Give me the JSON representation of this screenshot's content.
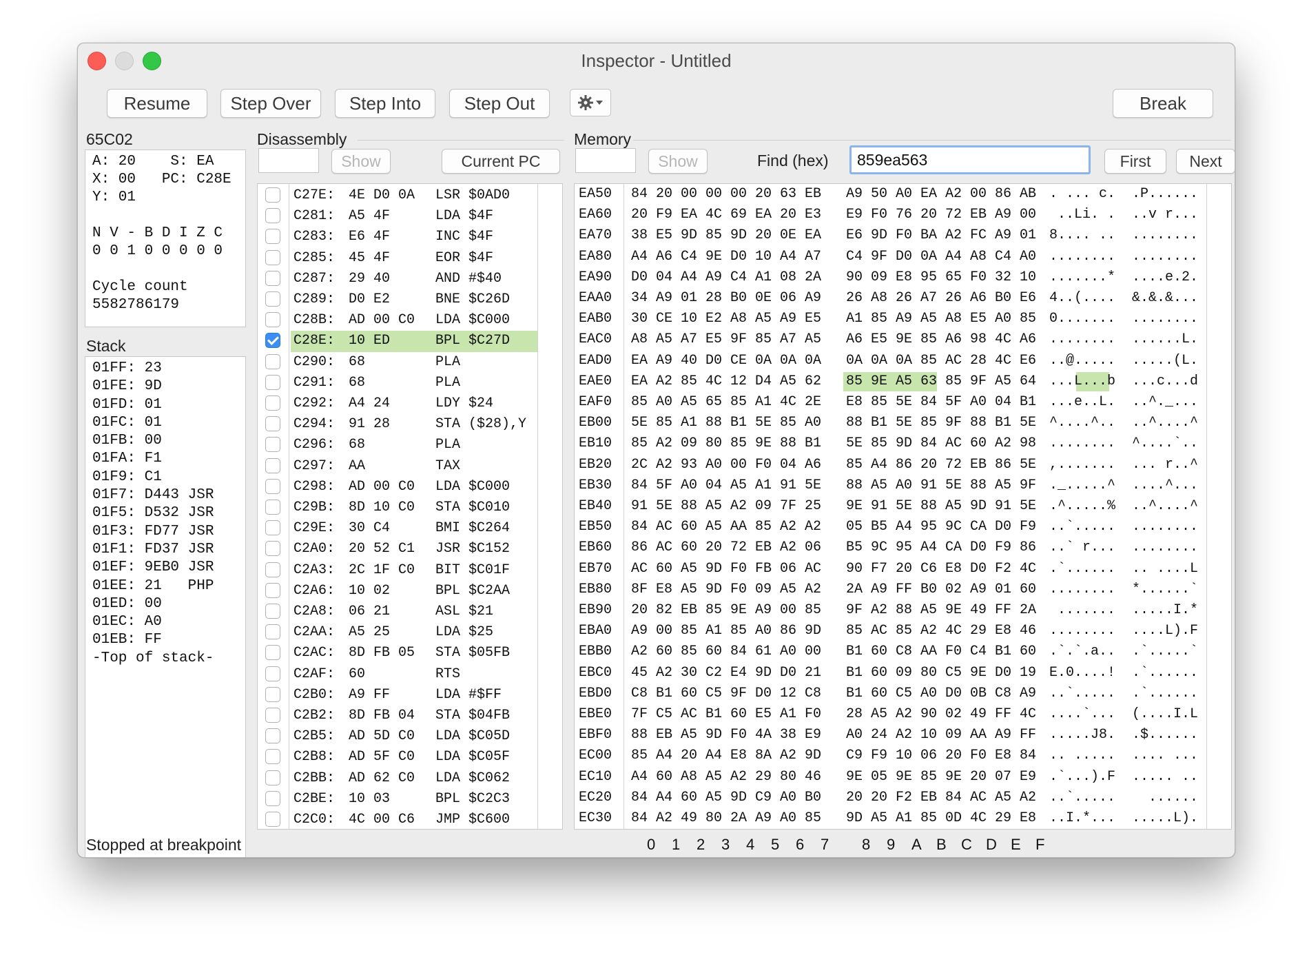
{
  "window": {
    "title": "Inspector - Untitled"
  },
  "toolbar": {
    "resume": "Resume",
    "step_over": "Step Over",
    "step_into": "Step Into",
    "step_out": "Step Out",
    "break": "Break"
  },
  "cpu": {
    "label": "65C02",
    "lines": [
      "A: 20    S: EA",
      "X: 00   PC: C28E",
      "Y: 01",
      "",
      "N V - B D I Z C",
      "0 0 1 0 0 0 0 0",
      "",
      "Cycle count",
      "5582786179"
    ]
  },
  "stack": {
    "label": "Stack",
    "lines": [
      "01FF: 23",
      "01FE: 9D",
      "01FD: 01",
      "01FC: 01",
      "01FB: 00",
      "01FA: F1",
      "01F9: C1",
      "01F7: D443 JSR",
      "01F5: D532 JSR",
      "01F3: FD77 JSR",
      "01F1: FD37 JSR",
      "01EF: 9EB0 JSR",
      "01EE: 21   PHP",
      "01ED: 00",
      "01EC: A0",
      "01EB: FF",
      "-Top of stack-"
    ]
  },
  "disassembly": {
    "label": "Disassembly",
    "show": "Show",
    "current_pc": "Current PC",
    "rows": [
      {
        "addr": "C27E:",
        "bytes": "4E D0 0A",
        "instr": "LSR $0AD0"
      },
      {
        "addr": "C281:",
        "bytes": "A5 4F",
        "instr": "LDA $4F"
      },
      {
        "addr": "C283:",
        "bytes": "E6 4F",
        "instr": "INC $4F"
      },
      {
        "addr": "C285:",
        "bytes": "45 4F",
        "instr": "EOR $4F"
      },
      {
        "addr": "C287:",
        "bytes": "29 40",
        "instr": "AND #$40"
      },
      {
        "addr": "C289:",
        "bytes": "D0 E2",
        "instr": "BNE $C26D"
      },
      {
        "addr": "C28B:",
        "bytes": "AD 00 C0",
        "instr": "LDA $C000"
      },
      {
        "addr": "C28E:",
        "bytes": "10 ED",
        "instr": "BPL $C27D"
      },
      {
        "addr": "C290:",
        "bytes": "68",
        "instr": "PLA"
      },
      {
        "addr": "C291:",
        "bytes": "68",
        "instr": "PLA"
      },
      {
        "addr": "C292:",
        "bytes": "A4 24",
        "instr": "LDY $24"
      },
      {
        "addr": "C294:",
        "bytes": "91 28",
        "instr": "STA ($28),Y"
      },
      {
        "addr": "C296:",
        "bytes": "68",
        "instr": "PLA"
      },
      {
        "addr": "C297:",
        "bytes": "AA",
        "instr": "TAX"
      },
      {
        "addr": "C298:",
        "bytes": "AD 00 C0",
        "instr": "LDA $C000"
      },
      {
        "addr": "C29B:",
        "bytes": "8D 10 C0",
        "instr": "STA $C010"
      },
      {
        "addr": "C29E:",
        "bytes": "30 C4",
        "instr": "BMI $C264"
      },
      {
        "addr": "C2A0:",
        "bytes": "20 52 C1",
        "instr": "JSR $C152"
      },
      {
        "addr": "C2A3:",
        "bytes": "2C 1F C0",
        "instr": "BIT $C01F"
      },
      {
        "addr": "C2A6:",
        "bytes": "10 02",
        "instr": "BPL $C2AA"
      },
      {
        "addr": "C2A8:",
        "bytes": "06 21",
        "instr": "ASL $21"
      },
      {
        "addr": "C2AA:",
        "bytes": "A5 25",
        "instr": "LDA $25"
      },
      {
        "addr": "C2AC:",
        "bytes": "8D FB 05",
        "instr": "STA $05FB"
      },
      {
        "addr": "C2AF:",
        "bytes": "60",
        "instr": "RTS"
      },
      {
        "addr": "C2B0:",
        "bytes": "A9 FF",
        "instr": "LDA #$FF"
      },
      {
        "addr": "C2B2:",
        "bytes": "8D FB 04",
        "instr": "STA $04FB"
      },
      {
        "addr": "C2B5:",
        "bytes": "AD 5D C0",
        "instr": "LDA $C05D"
      },
      {
        "addr": "C2B8:",
        "bytes": "AD 5F C0",
        "instr": "LDA $C05F"
      },
      {
        "addr": "C2BB:",
        "bytes": "AD 62 C0",
        "instr": "LDA $C062"
      },
      {
        "addr": "C2BE:",
        "bytes": "10 03",
        "instr": "BPL $C2C3"
      },
      {
        "addr": "C2C0:",
        "bytes": "4C 00 C6",
        "instr": "JMP $C600"
      }
    ],
    "checked_row": 7
  },
  "memory": {
    "label": "Memory",
    "show": "Show",
    "find_label": "Find (hex)",
    "find_value": "859ea563",
    "first": "First",
    "next": "Next",
    "rows": [
      {
        "a": "EA50",
        "b1": "84 20 00 00 00 20 63 EB",
        "b2": "A9 50 A0 EA A2 00 86 AB",
        "c": ". ... c.  .P......"
      },
      {
        "a": "EA60",
        "b1": "20 F9 EA 4C 69 EA 20 E3",
        "b2": "E9 F0 76 20 72 EB A9 00",
        "c": " ..Li. .  ..v r..."
      },
      {
        "a": "EA70",
        "b1": "38 E5 9D 85 9D 20 0E EA",
        "b2": "E6 9D F0 BA A2 FC A9 01",
        "c": "8.... ..  ........"
      },
      {
        "a": "EA80",
        "b1": "A4 A6 C4 9E D0 10 A4 A7",
        "b2": "C4 9F D0 0A A4 A8 C4 A0",
        "c": "........  ........"
      },
      {
        "a": "EA90",
        "b1": "D0 04 A4 A9 C4 A1 08 2A",
        "b2": "90 09 E8 95 65 F0 32 10",
        "c": ".......*  ....e.2."
      },
      {
        "a": "EAA0",
        "b1": "34 A9 01 28 B0 0E 06 A9",
        "b2": "26 A8 26 A7 26 A6 B0 E6",
        "c": "4..(....  &.&.&..."
      },
      {
        "a": "EAB0",
        "b1": "30 CE 10 E2 A8 A5 A9 E5",
        "b2": "A1 85 A9 A5 A8 E5 A0 85",
        "c": "0.......  ........"
      },
      {
        "a": "EAC0",
        "b1": "A8 A5 A7 E5 9F 85 A7 A5",
        "b2": "A6 E5 9E 85 A6 98 4C A6",
        "c": "........  ......L."
      },
      {
        "a": "EAD0",
        "b1": "EA A9 40 D0 CE 0A 0A 0A",
        "b2": "0A 0A 0A 85 AC 28 4C E6",
        "c": "..@.....  .....(L."
      },
      {
        "a": "EAE0",
        "b1": "EA A2 85 4C 12 D4 A5 62",
        "b2": "85 9E A5 63 85 9F A5 64",
        "c": "...L...b  ...c...d"
      },
      {
        "a": "EAF0",
        "b1": "85 A0 A5 65 85 A1 4C 2E",
        "b2": "E8 85 5E 84 5F A0 04 B1",
        "c": "...e..L.  ..^._..."
      },
      {
        "a": "EB00",
        "b1": "5E 85 A1 88 B1 5E 85 A0",
        "b2": "88 B1 5E 85 9F 88 B1 5E",
        "c": "^....^..  ..^....^"
      },
      {
        "a": "EB10",
        "b1": "85 A2 09 80 85 9E 88 B1",
        "b2": "5E 85 9D 84 AC 60 A2 98",
        "c": "........  ^....`.."
      },
      {
        "a": "EB20",
        "b1": "2C A2 93 A0 00 F0 04 A6",
        "b2": "85 A4 86 20 72 EB 86 5E",
        "c": ",.......  ... r..^"
      },
      {
        "a": "EB30",
        "b1": "84 5F A0 04 A5 A1 91 5E",
        "b2": "88 A5 A0 91 5E 88 A5 9F",
        "c": "._.....^  ....^..."
      },
      {
        "a": "EB40",
        "b1": "91 5E 88 A5 A2 09 7F 25",
        "b2": "9E 91 5E 88 A5 9D 91 5E",
        "c": ".^.....%  ..^....^"
      },
      {
        "a": "EB50",
        "b1": "84 AC 60 A5 AA 85 A2 A2",
        "b2": "05 B5 A4 95 9C CA D0 F9",
        "c": "..`.....  ........"
      },
      {
        "a": "EB60",
        "b1": "86 AC 60 20 72 EB A2 06",
        "b2": "B5 9C 95 A4 CA D0 F9 86",
        "c": "..` r...  ........"
      },
      {
        "a": "EB70",
        "b1": "AC 60 A5 9D F0 FB 06 AC",
        "b2": "90 F7 20 C6 E8 D0 F2 4C",
        "c": ".`......  .. ....L"
      },
      {
        "a": "EB80",
        "b1": "8F E8 A5 9D F0 09 A5 A2",
        "b2": "2A A9 FF B0 02 A9 01 60",
        "c": "........  *......`"
      },
      {
        "a": "EB90",
        "b1": "20 82 EB 85 9E A9 00 85",
        "b2": "9F A2 88 A5 9E 49 FF 2A",
        "c": " .......  .....I.*"
      },
      {
        "a": "EBA0",
        "b1": "A9 00 85 A1 85 A0 86 9D",
        "b2": "85 AC 85 A2 4C 29 E8 46",
        "c": "........  ....L).F"
      },
      {
        "a": "EBB0",
        "b1": "A2 60 85 60 84 61 A0 00",
        "b2": "B1 60 C8 AA F0 C4 B1 60",
        "c": ".`.`.a..  .`.....`"
      },
      {
        "a": "EBC0",
        "b1": "45 A2 30 C2 E4 9D D0 21",
        "b2": "B1 60 09 80 C5 9E D0 19",
        "c": "E.0....!  .`......"
      },
      {
        "a": "EBD0",
        "b1": "C8 B1 60 C5 9F D0 12 C8",
        "b2": "B1 60 C5 A0 D0 0B C8 A9",
        "c": "..`.....  .`......"
      },
      {
        "a": "EBE0",
        "b1": "7F C5 AC B1 60 E5 A1 F0",
        "b2": "28 A5 A2 90 02 49 FF 4C",
        "c": "....`...  (....I.L"
      },
      {
        "a": "EBF0",
        "b1": "88 EB A5 9D F0 4A 38 E9",
        "b2": "A0 24 A2 10 09 AA A9 FF",
        "c": ".....J8.  .$......"
      },
      {
        "a": "EC00",
        "b1": "85 A4 20 A4 E8 8A A2 9D",
        "b2": "C9 F9 10 06 20 F0 E8 84",
        "c": ".. .....  .... ..."
      },
      {
        "a": "EC10",
        "b1": "A4 60 A8 A5 A2 29 80 46",
        "b2": "9E 05 9E 85 9E 20 07 E9",
        "c": ".`...).F  ..... .."
      },
      {
        "a": "EC20",
        "b1": "84 A4 60 A5 9D C9 A0 B0",
        "b2": "20 20 F2 EB 84 AC A5 A2",
        "c": "..`.....    ......"
      },
      {
        "a": "EC30",
        "b1": "84 A2 49 80 2A A9 A0 85",
        "b2": "9D A5 A1 85 0D 4C 29 E8",
        "c": "..I.*...  .....L)."
      }
    ],
    "columns": [
      "0",
      "1",
      "2",
      "3",
      "4",
      "5",
      "6",
      "7",
      "8",
      "9",
      "A",
      "B",
      "C",
      "D",
      "E",
      "F"
    ]
  },
  "status": "Stopped at breakpoint",
  "colors": {
    "highlight": "#c8e5ae",
    "check_blue": "#3b8ef5",
    "close": "#fc5e57",
    "zoom": "#33c748"
  }
}
